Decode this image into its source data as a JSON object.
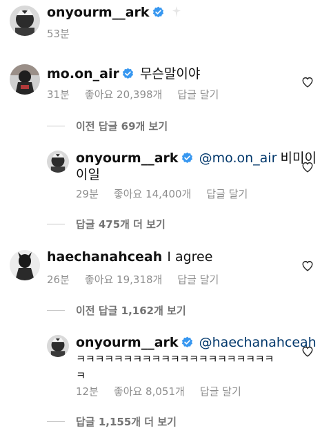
{
  "post": {
    "username": "onyourm__ark",
    "time": "53분"
  },
  "comments": [
    {
      "username": "mo.on_air",
      "text": "무슨말이야",
      "time": "31분",
      "likes": "좋아요 20,398개",
      "reply": "답글 달기",
      "view_replies": "이전 답글 69개 보기",
      "reply_item": {
        "username": "onyourm__ark",
        "mention": "@mo.on_air",
        "text_line1": "비미이",
        "text_line2": "이일",
        "time": "29분",
        "likes": "좋아요 14,400개",
        "reply": "답글 달기",
        "more_replies": "답글 475개 더 보기"
      }
    },
    {
      "username": "haechanahceah",
      "text": "I agree",
      "time": "26분",
      "likes": "좋아요 19,318개",
      "reply": "답글 달기",
      "view_replies": "이전 답글 1,162개 보기",
      "reply_item": {
        "username": "onyourm__ark",
        "mention": "@haechanahceah",
        "text_line1": "ㅋㅋㅋㅋㅋㅋㅋㅋㅋㅋㅋㅋㅋㅋㅋㅋㅋㅋㅋㅋㅋ",
        "text_line2": "ㅋ",
        "time": "12분",
        "likes": "좋아요 8,051개",
        "reply": "답글 달기",
        "more_replies": "답글 1,155개 더 보기"
      }
    }
  ],
  "icons": {
    "verified": "verified-badge-icon",
    "heart": "heart-outline-icon"
  },
  "colors": {
    "verified_blue": "#3797f0",
    "mention_blue": "#00376b",
    "meta_gray": "#8e8e8e"
  }
}
